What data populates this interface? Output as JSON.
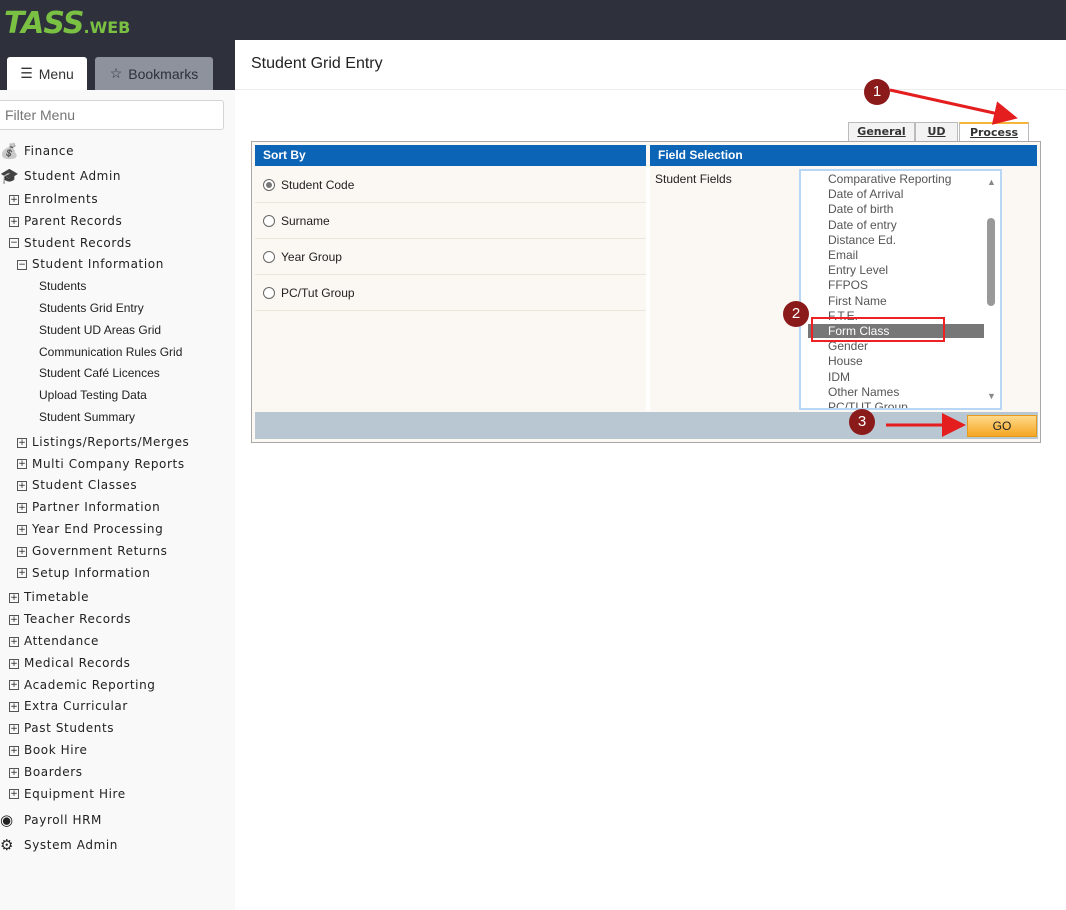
{
  "app": {
    "logo": "TASS",
    "logo_suffix": ".WEB"
  },
  "sidebar": {
    "tabs": {
      "menu": "Menu",
      "bookmarks": "Bookmarks"
    },
    "filter_placeholder": "Filter Menu",
    "items": [
      {
        "label": "Finance",
        "icon": "money-bag-icon"
      },
      {
        "label": "Student Admin",
        "icon": "graduation-cap-icon"
      },
      {
        "label": "Enrolments",
        "toggle": "+"
      },
      {
        "label": "Parent Records",
        "toggle": "+"
      },
      {
        "label": "Student Records",
        "toggle": "−"
      },
      {
        "label": "Student Information",
        "toggle": "−"
      },
      {
        "label": "Students"
      },
      {
        "label": "Students Grid Entry"
      },
      {
        "label": "Student UD Areas Grid"
      },
      {
        "label": "Communication Rules Grid"
      },
      {
        "label": "Student Café Licences"
      },
      {
        "label": "Upload Testing Data"
      },
      {
        "label": "Student Summary"
      },
      {
        "label": "Listings/Reports/Merges",
        "toggle": "+"
      },
      {
        "label": "Multi Company Reports",
        "toggle": "+"
      },
      {
        "label": "Student Classes",
        "toggle": "+"
      },
      {
        "label": "Partner Information",
        "toggle": "+"
      },
      {
        "label": "Year End Processing",
        "toggle": "+"
      },
      {
        "label": "Government Returns",
        "toggle": "+"
      },
      {
        "label": "Setup Information",
        "toggle": "+"
      },
      {
        "label": "Timetable",
        "toggle": "+"
      },
      {
        "label": "Teacher Records",
        "toggle": "+"
      },
      {
        "label": "Attendance",
        "toggle": "+"
      },
      {
        "label": "Medical Records",
        "toggle": "+"
      },
      {
        "label": "Academic Reporting",
        "toggle": "+"
      },
      {
        "label": "Extra Curricular",
        "toggle": "+"
      },
      {
        "label": "Past Students",
        "toggle": "+"
      },
      {
        "label": "Book Hire",
        "toggle": "+"
      },
      {
        "label": "Boarders",
        "toggle": "+"
      },
      {
        "label": "Equipment Hire",
        "toggle": "+"
      },
      {
        "label": "Payroll HRM",
        "icon": "user-circle-icon"
      },
      {
        "label": "System Admin",
        "icon": "gear-icon"
      }
    ]
  },
  "main": {
    "title": "Student Grid Entry",
    "tabs": [
      "General",
      "UD",
      "Process"
    ],
    "sort_by": {
      "header": "Sort By",
      "options": [
        "Student Code",
        "Surname",
        "Year Group",
        "PC/Tut Group"
      ],
      "selected": "Student Code"
    },
    "field_selection": {
      "header": "Field Selection",
      "label": "Student Fields",
      "items": [
        "Comparative Reporting",
        "Date of Arrival",
        "Date of birth",
        "Date of entry",
        "Distance Ed.",
        "Email",
        "Entry Level",
        "FFPOS",
        "First Name",
        "F.T.E.",
        "Form Class",
        "Gender",
        "House",
        "IDM",
        "Other Names",
        "PC/TUT Group"
      ],
      "selected": "Form Class"
    },
    "go_label": "GO"
  },
  "annotations": [
    "1",
    "2",
    "3"
  ],
  "colors": {
    "header_blue": "#0b64b5",
    "logo_green": "#7ac143",
    "go_orange": "#f5a623",
    "annotation": "#8b1a1a"
  }
}
